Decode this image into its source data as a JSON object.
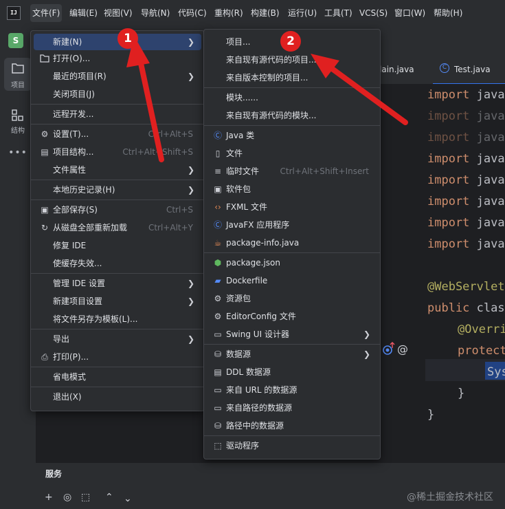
{
  "menubar": {
    "items": [
      "文件(F)",
      "编辑(E)",
      "视图(V)",
      "导航(N)",
      "代码(C)",
      "重构(R)",
      "构建(B)",
      "运行(U)",
      "工具(T)",
      "VCS(S)",
      "窗口(W)",
      "帮助(H)"
    ],
    "logo": "IJ"
  },
  "project_badge": "S",
  "sidebar": {
    "project_label": "项目",
    "structure_label": "结构",
    "more": "•••"
  },
  "tabs": [
    {
      "label": "lain.java",
      "icon": "java-class-icon"
    },
    {
      "label": "Test.java",
      "icon": "java-class-icon"
    }
  ],
  "code_lines": [
    {
      "kw": "import",
      "rest": " java",
      "dim": false
    },
    {
      "kw": "import",
      "rest": " java",
      "dim": true
    },
    {
      "kw": "import",
      "rest": " java",
      "dim": true
    },
    {
      "kw": "import",
      "rest": " java",
      "dim": false
    },
    {
      "kw": "import",
      "rest": " java",
      "dim": false
    },
    {
      "kw": "import",
      "rest": " java",
      "dim": false
    },
    {
      "kw": "import",
      "rest": " java",
      "dim": false
    },
    {
      "kw": "import",
      "rest": " java",
      "dim": false
    }
  ],
  "code_tail": {
    "annotation": "@WebServlet",
    "class_line_kw": "public",
    "class_line_rest": " clas",
    "override": "@Overri",
    "protect": "protect",
    "sys": "Sys",
    "close1": "}",
    "close2": "}"
  },
  "gutter_icons": {
    "impl": "●",
    "at": "@"
  },
  "services": {
    "title": "服务",
    "toolbar": [
      "+",
      "◎",
      "⬚",
      "⌃",
      "⌃"
    ]
  },
  "file_menu": [
    {
      "label": "新建(N)",
      "icon": "",
      "shortcut": "",
      "submenu": true,
      "selected": true
    },
    {
      "label": "打开(O)...",
      "icon": "folder-icon",
      "shortcut": "",
      "submenu": false
    },
    {
      "label": "最近的项目(R)",
      "icon": "",
      "shortcut": "",
      "submenu": true
    },
    {
      "label": "关闭项目(J)",
      "icon": "",
      "shortcut": "",
      "submenu": false
    },
    {
      "label": "远程开发...",
      "icon": "",
      "shortcut": "",
      "submenu": false
    },
    {
      "label": "设置(T)...",
      "icon": "gear-icon",
      "shortcut": "Ctrl+Alt+S",
      "submenu": false
    },
    {
      "label": "项目结构...",
      "icon": "project-structure-icon",
      "shortcut": "Ctrl+Alt+Shift+S",
      "submenu": false
    },
    {
      "label": "文件属性",
      "icon": "",
      "shortcut": "",
      "submenu": true
    },
    {
      "label": "本地历史记录(H)",
      "icon": "",
      "shortcut": "",
      "submenu": true
    },
    {
      "label": "全部保存(S)",
      "icon": "save-icon",
      "shortcut": "Ctrl+S",
      "submenu": false
    },
    {
      "label": "从磁盘全部重新加载",
      "icon": "reload-icon",
      "shortcut": "Ctrl+Alt+Y",
      "submenu": false
    },
    {
      "label": "修复 IDE",
      "icon": "",
      "shortcut": "",
      "submenu": false
    },
    {
      "label": "使缓存失效...",
      "icon": "",
      "shortcut": "",
      "submenu": false
    },
    {
      "label": "管理 IDE 设置",
      "icon": "",
      "shortcut": "",
      "submenu": true
    },
    {
      "label": "新建项目设置",
      "icon": "",
      "shortcut": "",
      "submenu": true
    },
    {
      "label": "将文件另存为模板(L)...",
      "icon": "",
      "shortcut": "",
      "submenu": false
    },
    {
      "label": "导出",
      "icon": "",
      "shortcut": "",
      "submenu": true
    },
    {
      "label": "打印(P)...",
      "icon": "print-icon",
      "shortcut": "",
      "submenu": false
    },
    {
      "label": "省电模式",
      "icon": "",
      "shortcut": "",
      "submenu": false
    },
    {
      "label": "退出(X)",
      "icon": "",
      "shortcut": "",
      "submenu": false
    }
  ],
  "new_menu": [
    {
      "label": "项目...",
      "icon": "",
      "shortcut": "",
      "submenu": false
    },
    {
      "label": "来自现有源代码的项目...",
      "icon": "",
      "shortcut": "",
      "submenu": false
    },
    {
      "label": "来自版本控制的项目...",
      "icon": "",
      "shortcut": "",
      "submenu": false
    },
    {
      "label": "模块......",
      "icon": "",
      "shortcut": "",
      "submenu": false
    },
    {
      "label": "来自现有源代码的模块...",
      "icon": "",
      "shortcut": "",
      "submenu": false
    },
    {
      "label": "Java 类",
      "icon": "java-class-icon",
      "shortcut": "",
      "submenu": false
    },
    {
      "label": "文件",
      "icon": "file-icon",
      "shortcut": "",
      "submenu": false
    },
    {
      "label": "临时文件",
      "icon": "scratch-file-icon",
      "shortcut": "Ctrl+Alt+Shift+Insert",
      "submenu": false
    },
    {
      "label": "软件包",
      "icon": "package-icon",
      "shortcut": "",
      "submenu": false
    },
    {
      "label": "FXML 文件",
      "icon": "fxml-icon",
      "shortcut": "",
      "submenu": false
    },
    {
      "label": "JavaFX 应用程序",
      "icon": "javafx-icon",
      "shortcut": "",
      "submenu": false
    },
    {
      "label": "package-info.java",
      "icon": "package-info-icon",
      "shortcut": "",
      "submenu": false
    },
    {
      "label": "package.json",
      "icon": "nodejs-icon",
      "shortcut": "",
      "submenu": false
    },
    {
      "label": "Dockerfile",
      "icon": "docker-icon",
      "shortcut": "",
      "submenu": false
    },
    {
      "label": "资源包",
      "icon": "resource-bundle-icon",
      "shortcut": "",
      "submenu": false
    },
    {
      "label": "EditorConfig 文件",
      "icon": "editorconfig-icon",
      "shortcut": "",
      "submenu": false
    },
    {
      "label": "Swing UI 设计器",
      "icon": "swing-designer-icon",
      "shortcut": "",
      "submenu": true
    },
    {
      "label": "数据源",
      "icon": "datasource-icon",
      "shortcut": "",
      "submenu": true
    },
    {
      "label": "DDL 数据源",
      "icon": "ddl-icon",
      "shortcut": "",
      "submenu": false
    },
    {
      "label": "来自 URL 的数据源",
      "icon": "url-icon",
      "shortcut": "",
      "submenu": false
    },
    {
      "label": "来自路径的数据源",
      "icon": "folder-icon",
      "shortcut": "",
      "submenu": false
    },
    {
      "label": "路径中的数据源",
      "icon": "datasource-icon",
      "shortcut": "",
      "submenu": false
    },
    {
      "label": "驱动程序",
      "icon": "driver-icon",
      "shortcut": "",
      "submenu": false
    }
  ],
  "annotations": {
    "badge1": "1",
    "badge2": "2",
    "color": "#e02020"
  },
  "watermark": "@稀土掘金技术社区",
  "colors": {
    "accent": "#2e436e",
    "keyword": "#cf8e6d",
    "annotation": "#b3ae60",
    "background": "#1e1f22"
  }
}
